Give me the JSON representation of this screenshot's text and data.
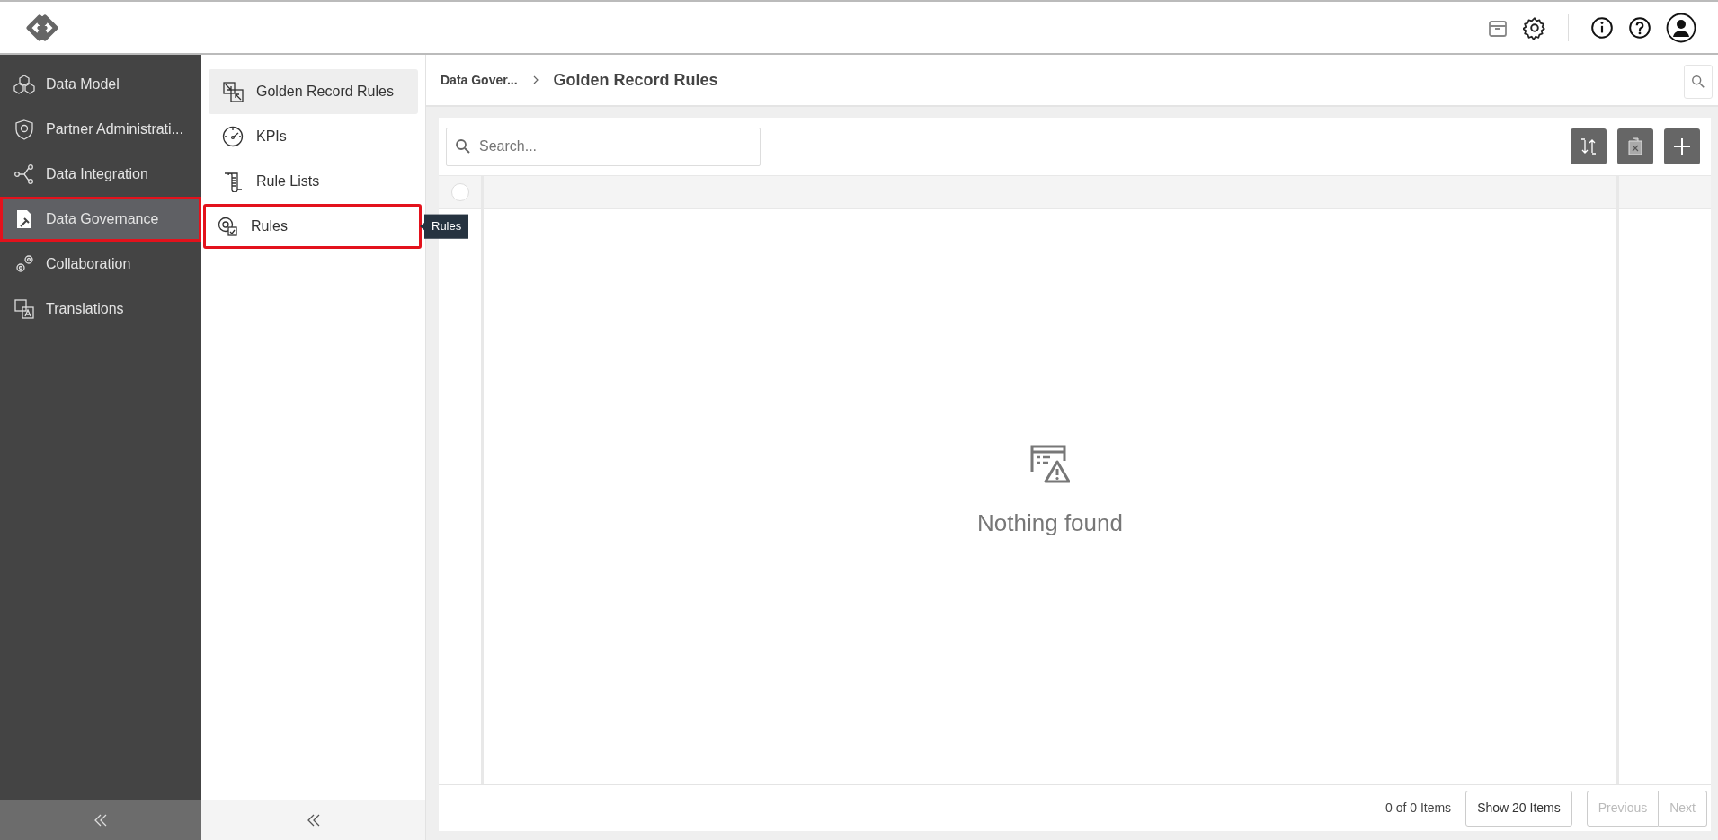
{
  "nav": [
    {
      "label": "Data Model",
      "selected": false,
      "highlighted": false
    },
    {
      "label": "Partner Administrati...",
      "selected": false,
      "highlighted": false
    },
    {
      "label": "Data Integration",
      "selected": false,
      "highlighted": false
    },
    {
      "label": "Data Governance",
      "selected": true,
      "highlighted": true
    },
    {
      "label": "Collaboration",
      "selected": false,
      "highlighted": false
    },
    {
      "label": "Translations",
      "selected": false,
      "highlighted": false
    }
  ],
  "subnav": [
    {
      "label": "Golden Record Rules",
      "selected": true,
      "highlighted": false
    },
    {
      "label": "KPIs",
      "selected": false,
      "highlighted": false
    },
    {
      "label": "Rule Lists",
      "selected": false,
      "highlighted": false
    },
    {
      "label": "Rules",
      "selected": false,
      "highlighted": true,
      "tooltip": "Rules"
    }
  ],
  "breadcrumb": [
    "Data Gover...",
    "Golden Record Rules"
  ],
  "search": {
    "placeholder": "Search..."
  },
  "select_all": {
    "checked": false
  },
  "empty_message": "Nothing found",
  "pagination": {
    "summary": "0 of 0 Items",
    "page_size": "Show 20 Items",
    "previous": "Previous",
    "next": "Next",
    "previous_disabled": true,
    "next_disabled": true
  }
}
